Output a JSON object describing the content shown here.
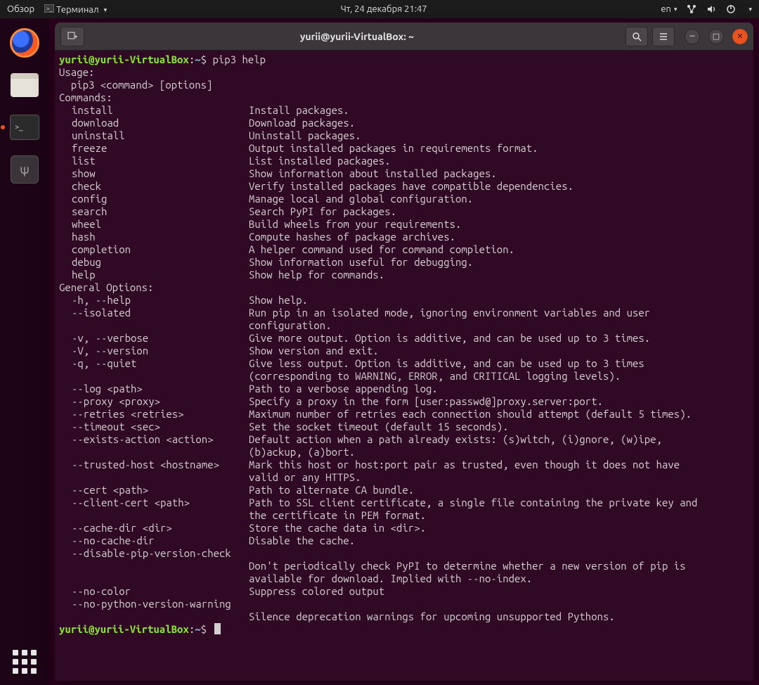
{
  "panel": {
    "overview": "Обзор",
    "terminal_menu": "Терминал",
    "datetime": "Чт, 24 декабря  21:47",
    "lang": "en"
  },
  "window": {
    "title": "yurii@yurii-VirtualBox: ~"
  },
  "prompt": {
    "user_host": "yurii@yurii-VirtualBox",
    "path": "~",
    "command": "pip3 help"
  },
  "usage_header": "Usage:",
  "usage_line": "  pip3 <command> [options]",
  "commands_header": "Commands:",
  "commands": [
    {
      "name": "install",
      "desc": "Install packages."
    },
    {
      "name": "download",
      "desc": "Download packages."
    },
    {
      "name": "uninstall",
      "desc": "Uninstall packages."
    },
    {
      "name": "freeze",
      "desc": "Output installed packages in requirements format."
    },
    {
      "name": "list",
      "desc": "List installed packages."
    },
    {
      "name": "show",
      "desc": "Show information about installed packages."
    },
    {
      "name": "check",
      "desc": "Verify installed packages have compatible dependencies."
    },
    {
      "name": "config",
      "desc": "Manage local and global configuration."
    },
    {
      "name": "search",
      "desc": "Search PyPI for packages."
    },
    {
      "name": "wheel",
      "desc": "Build wheels from your requirements."
    },
    {
      "name": "hash",
      "desc": "Compute hashes of package archives."
    },
    {
      "name": "completion",
      "desc": "A helper command used for command completion."
    },
    {
      "name": "debug",
      "desc": "Show information useful for debugging."
    },
    {
      "name": "help",
      "desc": "Show help for commands."
    }
  ],
  "options_header": "General Options:",
  "options": [
    {
      "name": "-h, --help",
      "desc": [
        "Show help."
      ]
    },
    {
      "name": "--isolated",
      "desc": [
        "Run pip in an isolated mode, ignoring environment variables and user",
        "configuration."
      ]
    },
    {
      "name": "-v, --verbose",
      "desc": [
        "Give more output. Option is additive, and can be used up to 3 times."
      ]
    },
    {
      "name": "-V, --version",
      "desc": [
        "Show version and exit."
      ]
    },
    {
      "name": "-q, --quiet",
      "desc": [
        "Give less output. Option is additive, and can be used up to 3 times",
        "(corresponding to WARNING, ERROR, and CRITICAL logging levels)."
      ]
    },
    {
      "name": "--log <path>",
      "desc": [
        "Path to a verbose appending log."
      ]
    },
    {
      "name": "--proxy <proxy>",
      "desc": [
        "Specify a proxy in the form [user:passwd@]proxy.server:port."
      ]
    },
    {
      "name": "--retries <retries>",
      "desc": [
        "Maximum number of retries each connection should attempt (default 5 times)."
      ]
    },
    {
      "name": "--timeout <sec>",
      "desc": [
        "Set the socket timeout (default 15 seconds)."
      ]
    },
    {
      "name": "--exists-action <action>",
      "desc": [
        "Default action when a path already exists: (s)witch, (i)gnore, (w)ipe,",
        "(b)ackup, (a)bort."
      ]
    },
    {
      "name": "--trusted-host <hostname>",
      "desc": [
        "Mark this host or host:port pair as trusted, even though it does not have",
        "valid or any HTTPS."
      ]
    },
    {
      "name": "--cert <path>",
      "desc": [
        "Path to alternate CA bundle."
      ]
    },
    {
      "name": "--client-cert <path>",
      "desc": [
        "Path to SSL client certificate, a single file containing the private key and",
        "the certificate in PEM format."
      ]
    },
    {
      "name": "--cache-dir <dir>",
      "desc": [
        "Store the cache data in <dir>."
      ]
    },
    {
      "name": "--no-cache-dir",
      "desc": [
        "Disable the cache."
      ]
    },
    {
      "name": "--disable-pip-version-check",
      "desc": [
        "",
        "Don't periodically check PyPI to determine whether a new version of pip is",
        "available for download. Implied with --no-index."
      ]
    },
    {
      "name": "--no-color",
      "desc": [
        "Suppress colored output"
      ]
    },
    {
      "name": "--no-python-version-warning",
      "desc": [
        "",
        "Silence deprecation warnings for upcoming unsupported Pythons."
      ]
    }
  ]
}
